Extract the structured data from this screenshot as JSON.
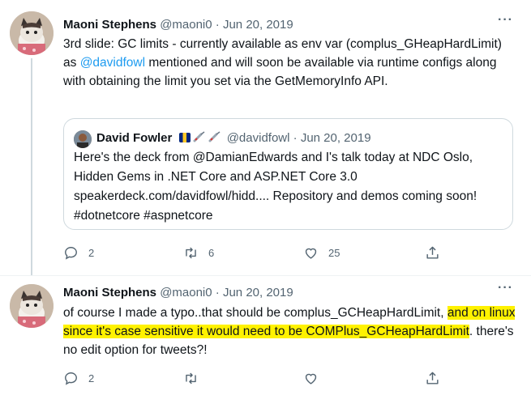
{
  "tweets": [
    {
      "author_name": "Maoni Stephens",
      "handle": "@maoni0",
      "date": "Jun 20, 2019",
      "text_before_mention": "3rd slide: GC limits - currently available as env var (complus_GHeapHardLimit) as ",
      "mention": "@davidfowl",
      "text_after_mention": " mentioned and will soon be available via runtime configs along with obtaining the limit you set via the GetMemoryInfo API.",
      "quote": {
        "author_name": "David Fowler",
        "handle": "@davidfowl",
        "date": "Jun 20, 2019",
        "text": "Here's the deck from @DamianEdwards and I's talk today at NDC Oslo, Hidden Gems in .NET Core and ASP.NET Core 3.0 speakerdeck.com/davidfowl/hidd.... Repository and demos coming soon! #dotnetcore #aspnetcore"
      },
      "replies": "2",
      "retweets": "6",
      "likes": "25"
    },
    {
      "author_name": "Maoni Stephens",
      "handle": "@maoni0",
      "date": "Jun 20, 2019",
      "text_before_highlight": "of course I made a typo..that should be complus_GCHeapHardLimit, ",
      "highlighted_text": "and on linux since it's case sensitive it would need to be COMPlus_GCHeapHardLimit",
      "text_after_highlight": ". there's no edit option for tweets?!",
      "replies": "2",
      "retweets": "",
      "likes": "",
      "highlight_color": "#fff200"
    }
  ],
  "separator": "·",
  "more_icon": "···",
  "icons": [
    "reply-icon",
    "retweet-icon",
    "like-icon",
    "share-icon",
    "more-icon",
    "barbados-flag-icon",
    "syringe-icon"
  ],
  "colors": {
    "link": "#1d9bf0",
    "muted": "#536471",
    "text": "#0f1419"
  }
}
